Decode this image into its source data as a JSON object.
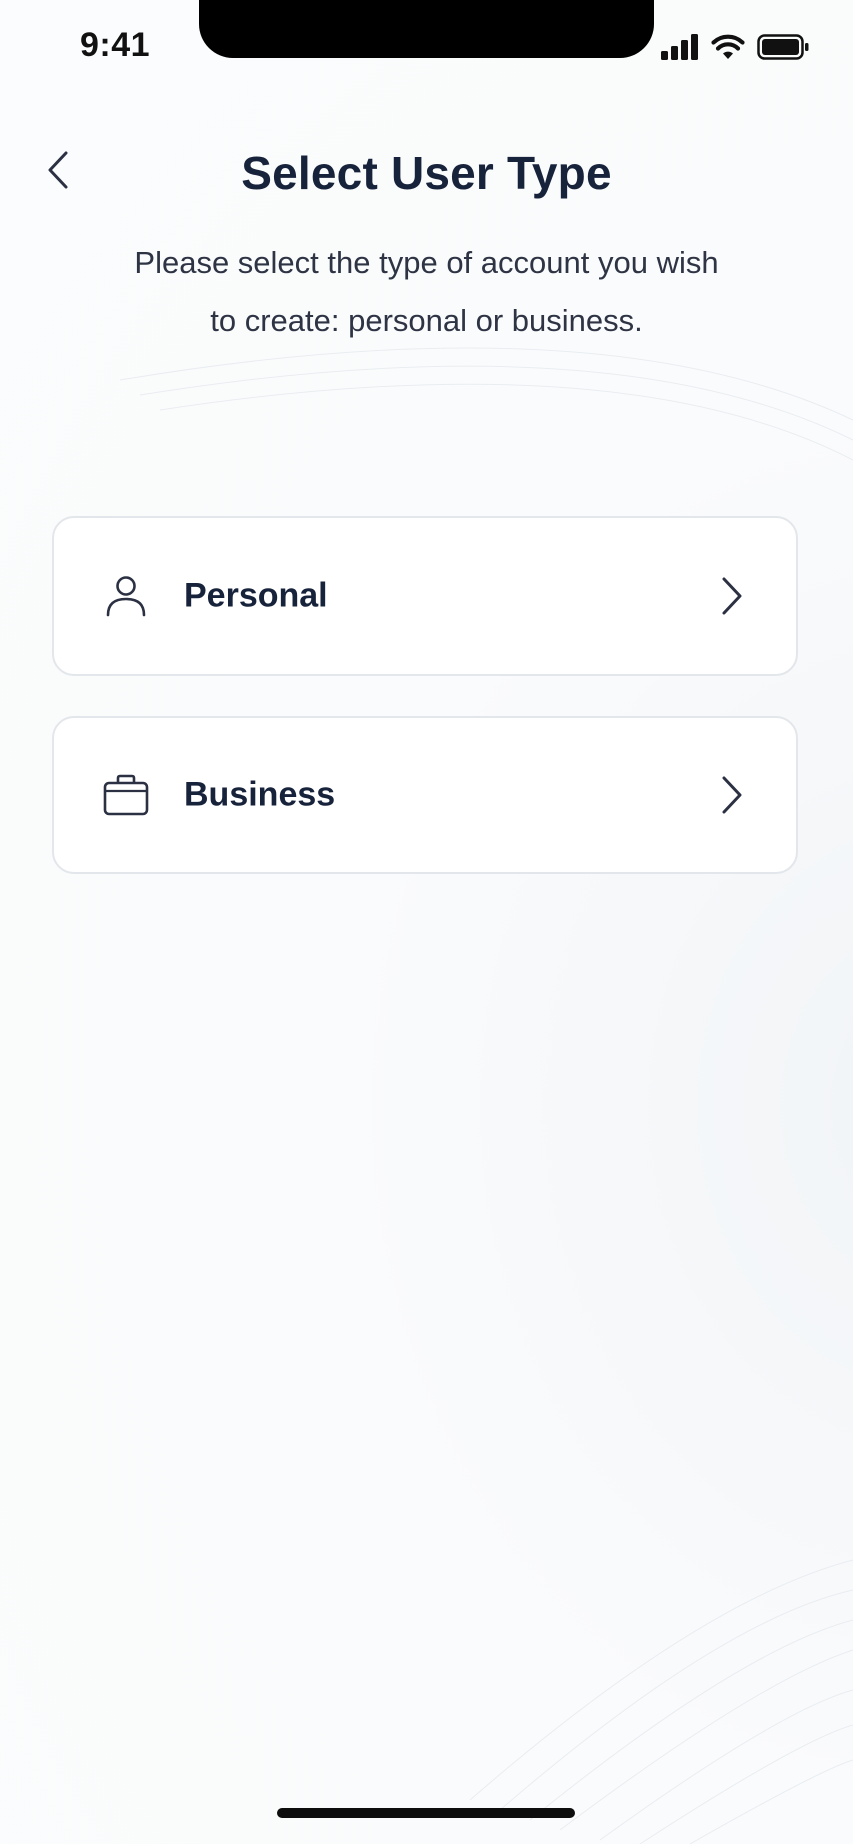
{
  "status_bar": {
    "time": "9:41",
    "icons": [
      "cellular-signal-icon",
      "wifi-icon",
      "battery-icon"
    ]
  },
  "header": {
    "back_icon": "chevron-left-icon",
    "title": "Select User Type",
    "subtitle": "Please select the type of account you wish to create: personal or business."
  },
  "options": [
    {
      "label": "Personal",
      "icon": "person-icon",
      "chevron": "chevron-right-icon"
    },
    {
      "label": "Business",
      "icon": "briefcase-icon",
      "chevron": "chevron-right-icon"
    }
  ],
  "colors": {
    "background": "#fafbfc",
    "text_primary": "#17223b",
    "text_secondary": "#2e3444",
    "card_background": "#ffffff",
    "card_border": "#e3e6ea"
  }
}
